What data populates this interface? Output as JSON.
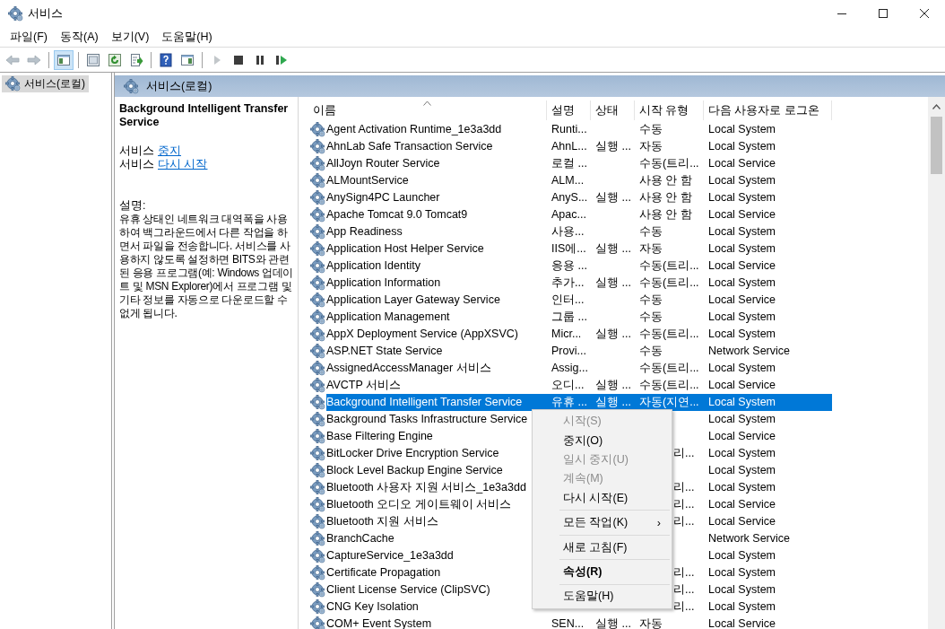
{
  "window": {
    "title": "서비스"
  },
  "menu_bar": [
    "파일(F)",
    "동작(A)",
    "보기(V)",
    "도움말(H)"
  ],
  "toolbar": [
    {
      "kind": "back",
      "disabled": true,
      "pressed": false
    },
    {
      "kind": "forward",
      "disabled": true,
      "pressed": false
    },
    {
      "kind": "separator"
    },
    {
      "kind": "tree",
      "disabled": false,
      "pressed": true
    },
    {
      "kind": "separator"
    },
    {
      "kind": "properties",
      "disabled": false,
      "pressed": false
    },
    {
      "kind": "refresh",
      "disabled": false,
      "pressed": false
    },
    {
      "kind": "export",
      "disabled": false,
      "pressed": false
    },
    {
      "kind": "separator"
    },
    {
      "kind": "help",
      "disabled": false,
      "pressed": false
    },
    {
      "kind": "pane",
      "disabled": false,
      "pressed": false
    },
    {
      "kind": "separator"
    },
    {
      "kind": "play",
      "disabled": true,
      "pressed": false
    },
    {
      "kind": "stop",
      "disabled": false,
      "pressed": false
    },
    {
      "kind": "pause",
      "disabled": false,
      "pressed": false
    },
    {
      "kind": "resume",
      "disabled": false,
      "pressed": false
    }
  ],
  "tree": [
    {
      "label": "서비스(로컬)",
      "selected": true
    }
  ],
  "pane_header": "서비스(로컬)",
  "details": {
    "title": "Background Intelligent Transfer Service",
    "actions": [
      {
        "prefix": "서비스",
        "link": "중지"
      },
      {
        "prefix": "서비스",
        "link": "다시 시작"
      }
    ],
    "description_label": "설명:",
    "description": "유휴 상태인 네트워크 대역폭을 사용하여 백그라운드에서 다른 작업을 하면서 파일을 전송합니다. 서비스를 사용하지 않도록 설정하면 BITS와 관련된 응용 프로그램(예: Windows 업데이트 및 MSN Explorer)에서 프로그램 및 기타 정보를 자동으로 다운로드할 수 없게 됩니다."
  },
  "table": {
    "columns": [
      {
        "label": "이름",
        "sorted": true
      },
      {
        "label": "설명",
        "sorted": false
      },
      {
        "label": "상태",
        "sorted": false
      },
      {
        "label": "시작 유형",
        "sorted": false
      },
      {
        "label": "다음 사용자로 로그온",
        "sorted": false
      }
    ],
    "rows": [
      {
        "name": "Agent Activation Runtime_1e3a3dd",
        "desc": "Runti...",
        "status": "",
        "startup": "수동",
        "logon": "Local System",
        "selected": false
      },
      {
        "name": "AhnLab Safe Transaction Service",
        "desc": "AhnL...",
        "status": "실행 ...",
        "startup": "자동",
        "logon": "Local System",
        "selected": false
      },
      {
        "name": "AllJoyn Router Service",
        "desc": "로컬 ...",
        "status": "",
        "startup": "수동(트리...",
        "logon": "Local Service",
        "selected": false
      },
      {
        "name": "ALMountService",
        "desc": "ALM...",
        "status": "",
        "startup": "사용 안 함",
        "logon": "Local System",
        "selected": false
      },
      {
        "name": "AnySign4PC Launcher",
        "desc": "AnyS...",
        "status": "실행 ...",
        "startup": "사용 안 함",
        "logon": "Local System",
        "selected": false
      },
      {
        "name": "Apache Tomcat 9.0 Tomcat9",
        "desc": "Apac...",
        "status": "",
        "startup": "사용 안 함",
        "logon": "Local Service",
        "selected": false
      },
      {
        "name": "App Readiness",
        "desc": "사용...",
        "status": "",
        "startup": "수동",
        "logon": "Local System",
        "selected": false
      },
      {
        "name": "Application Host Helper Service",
        "desc": "IIS에...",
        "status": "실행 ...",
        "startup": "자동",
        "logon": "Local System",
        "selected": false
      },
      {
        "name": "Application Identity",
        "desc": "응용 ...",
        "status": "",
        "startup": "수동(트리...",
        "logon": "Local Service",
        "selected": false
      },
      {
        "name": "Application Information",
        "desc": "추가...",
        "status": "실행 ...",
        "startup": "수동(트리...",
        "logon": "Local System",
        "selected": false
      },
      {
        "name": "Application Layer Gateway Service",
        "desc": "인터...",
        "status": "",
        "startup": "수동",
        "logon": "Local Service",
        "selected": false
      },
      {
        "name": "Application Management",
        "desc": "그룹 ...",
        "status": "",
        "startup": "수동",
        "logon": "Local System",
        "selected": false
      },
      {
        "name": "AppX Deployment Service (AppXSVC)",
        "desc": "Micr...",
        "status": "실행 ...",
        "startup": "수동(트리...",
        "logon": "Local System",
        "selected": false
      },
      {
        "name": "ASP.NET State Service",
        "desc": "Provi...",
        "status": "",
        "startup": "수동",
        "logon": "Network Service",
        "selected": false
      },
      {
        "name": "AssignedAccessManager 서비스",
        "desc": "Assig...",
        "status": "",
        "startup": "수동(트리...",
        "logon": "Local System",
        "selected": false
      },
      {
        "name": "AVCTP 서비스",
        "desc": "오디...",
        "status": "실행 ...",
        "startup": "수동(트리...",
        "logon": "Local Service",
        "selected": false
      },
      {
        "name": "Background Intelligent Transfer Service",
        "desc": "유휴 ...",
        "status": "실행 ...",
        "startup": "자동(지연...",
        "logon": "Local System",
        "selected": true
      },
      {
        "name": "Background Tasks Infrastructure Service",
        "logon": "Local System",
        "selected": false
      },
      {
        "name": "Base Filtering Engine",
        "logon": "Local Service",
        "selected": false
      },
      {
        "name": "BitLocker Drive Encryption Service",
        "startup_tail": "리...",
        "logon": "Local System",
        "selected": false
      },
      {
        "name": "Block Level Backup Engine Service",
        "logon": "Local System",
        "selected": false
      },
      {
        "name": "Bluetooth 사용자 지원 서비스_1e3a3dd",
        "startup_tail": "리...",
        "logon": "Local System",
        "selected": false
      },
      {
        "name": "Bluetooth 오디오 게이트웨이 서비스",
        "startup_tail": "리...",
        "logon": "Local Service",
        "selected": false
      },
      {
        "name": "Bluetooth 지원 서비스",
        "startup_tail": "리...",
        "logon": "Local Service",
        "selected": false
      },
      {
        "name": "BranchCache",
        "logon": "Network Service",
        "selected": false
      },
      {
        "name": "CaptureService_1e3a3dd",
        "logon": "Local System",
        "selected": false
      },
      {
        "name": "Certificate Propagation",
        "startup_tail": "리...",
        "logon": "Local System",
        "selected": false
      },
      {
        "name": "Client License Service (ClipSVC)",
        "startup_tail": "리...",
        "logon": "Local System",
        "selected": false
      },
      {
        "name": "CNG Key Isolation",
        "startup_tail": "리...",
        "logon": "Local System",
        "selected": false
      },
      {
        "name": "COM+ Event System",
        "desc": "SEN...",
        "status": "실행 ...",
        "startup": "자동",
        "logon": "Local Service",
        "selected": false
      }
    ]
  },
  "context_menu": [
    {
      "kind": "item",
      "label": "시작(S)",
      "disabled": true,
      "bold": false
    },
    {
      "kind": "item",
      "label": "중지(O)",
      "disabled": false,
      "bold": false
    },
    {
      "kind": "item",
      "label": "일시 중지(U)",
      "disabled": true,
      "bold": false
    },
    {
      "kind": "item",
      "label": "계속(M)",
      "disabled": true,
      "bold": false
    },
    {
      "kind": "item",
      "label": "다시 시작(E)",
      "disabled": false,
      "bold": false
    },
    {
      "kind": "separator"
    },
    {
      "kind": "submenu",
      "label": "모든 작업(K)",
      "arrow": "›",
      "disabled": false,
      "bold": false
    },
    {
      "kind": "separator"
    },
    {
      "kind": "item",
      "label": "새로 고침(F)",
      "disabled": false,
      "bold": false
    },
    {
      "kind": "separator"
    },
    {
      "kind": "item",
      "label": "속성(R)",
      "disabled": false,
      "bold": true
    },
    {
      "kind": "separator"
    },
    {
      "kind": "item",
      "label": "도움말(H)",
      "disabled": false,
      "bold": false
    }
  ]
}
